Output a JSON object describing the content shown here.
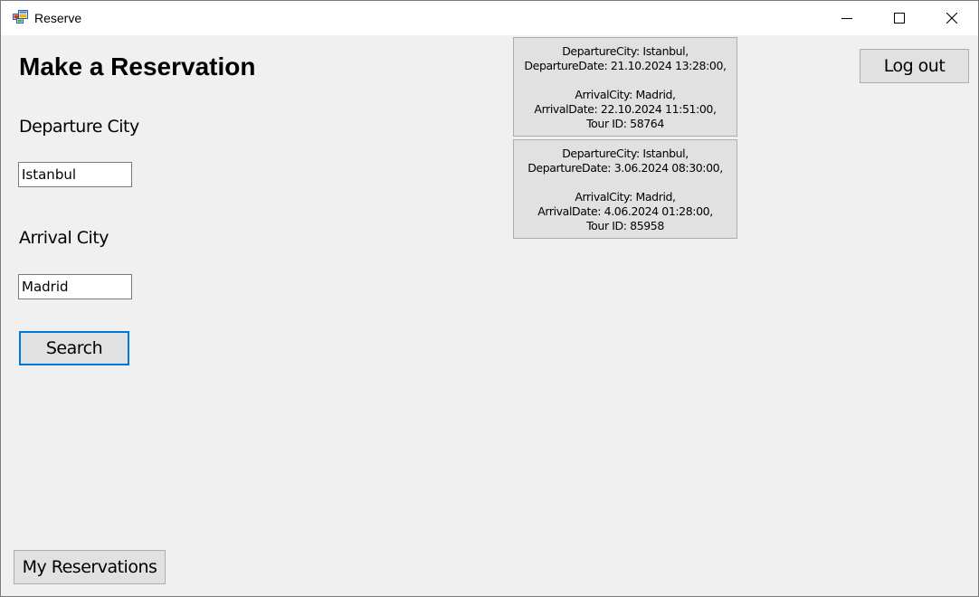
{
  "window": {
    "title": "Reserve",
    "app_icon": "forms-app-icon",
    "controls": {
      "minimize_icon": "minimize-icon",
      "maximize_icon": "maximize-icon",
      "close_icon": "close-icon"
    }
  },
  "form": {
    "heading": "Make a Reservation",
    "departure_label": "Departure City",
    "departure_value": "Istanbul",
    "arrival_label": "Arrival City",
    "arrival_value": "Madrid",
    "search_label": "Search"
  },
  "header": {
    "logout_label": "Log out"
  },
  "footer": {
    "my_reservations_label": "My Reservations"
  },
  "tours": [
    {
      "departure_city_line": "DepartureCity:  Istanbul,",
      "departure_date_line": "DepartureDate: 21.10.2024 13:28:00,",
      "arrival_city_line": "ArrivalCity:  Madrid,",
      "arrival_date_line": "ArrivalDate: 22.10.2024 11:51:00,",
      "tour_id_line": "Tour ID: 58764"
    },
    {
      "departure_city_line": "DepartureCity:  Istanbul,",
      "departure_date_line": "DepartureDate: 3.06.2024 08:30:00,",
      "arrival_city_line": "ArrivalCity:  Madrid,",
      "arrival_date_line": "ArrivalDate: 4.06.2024 01:28:00,",
      "tour_id_line": "Tour ID: 85958"
    }
  ],
  "colors": {
    "focus_border": "#0078d7",
    "window_background": "#f0f0f0",
    "button_background": "#e1e1e1"
  }
}
